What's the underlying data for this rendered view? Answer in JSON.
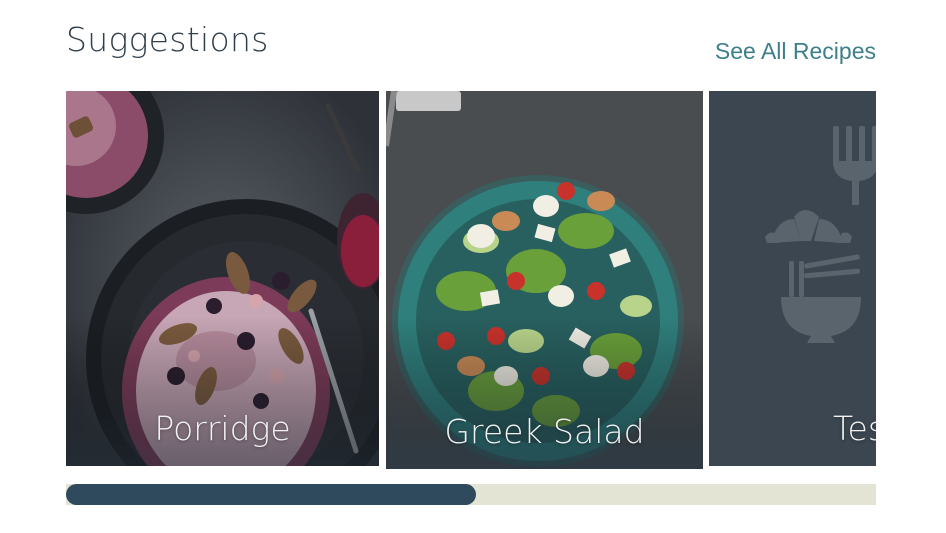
{
  "section": {
    "title": "Suggestions",
    "see_all_label": "See All Recipes"
  },
  "cards": [
    {
      "label": "Porridge",
      "image": "porridge-bowl-photo"
    },
    {
      "label": "Greek Salad",
      "image": "greek-salad-bowl-photo"
    },
    {
      "label": "Tes",
      "image": "recipe-placeholder-icons"
    }
  ],
  "scrollbar": {
    "position_fraction": 0.506
  },
  "colors": {
    "title": "#2f3e4a",
    "link": "#3d7f8a",
    "placeholder_bg": "#3b4650",
    "placeholder_icon": "#59646d",
    "track": "#e4e4d4",
    "thumb": "#2e4a5c"
  }
}
